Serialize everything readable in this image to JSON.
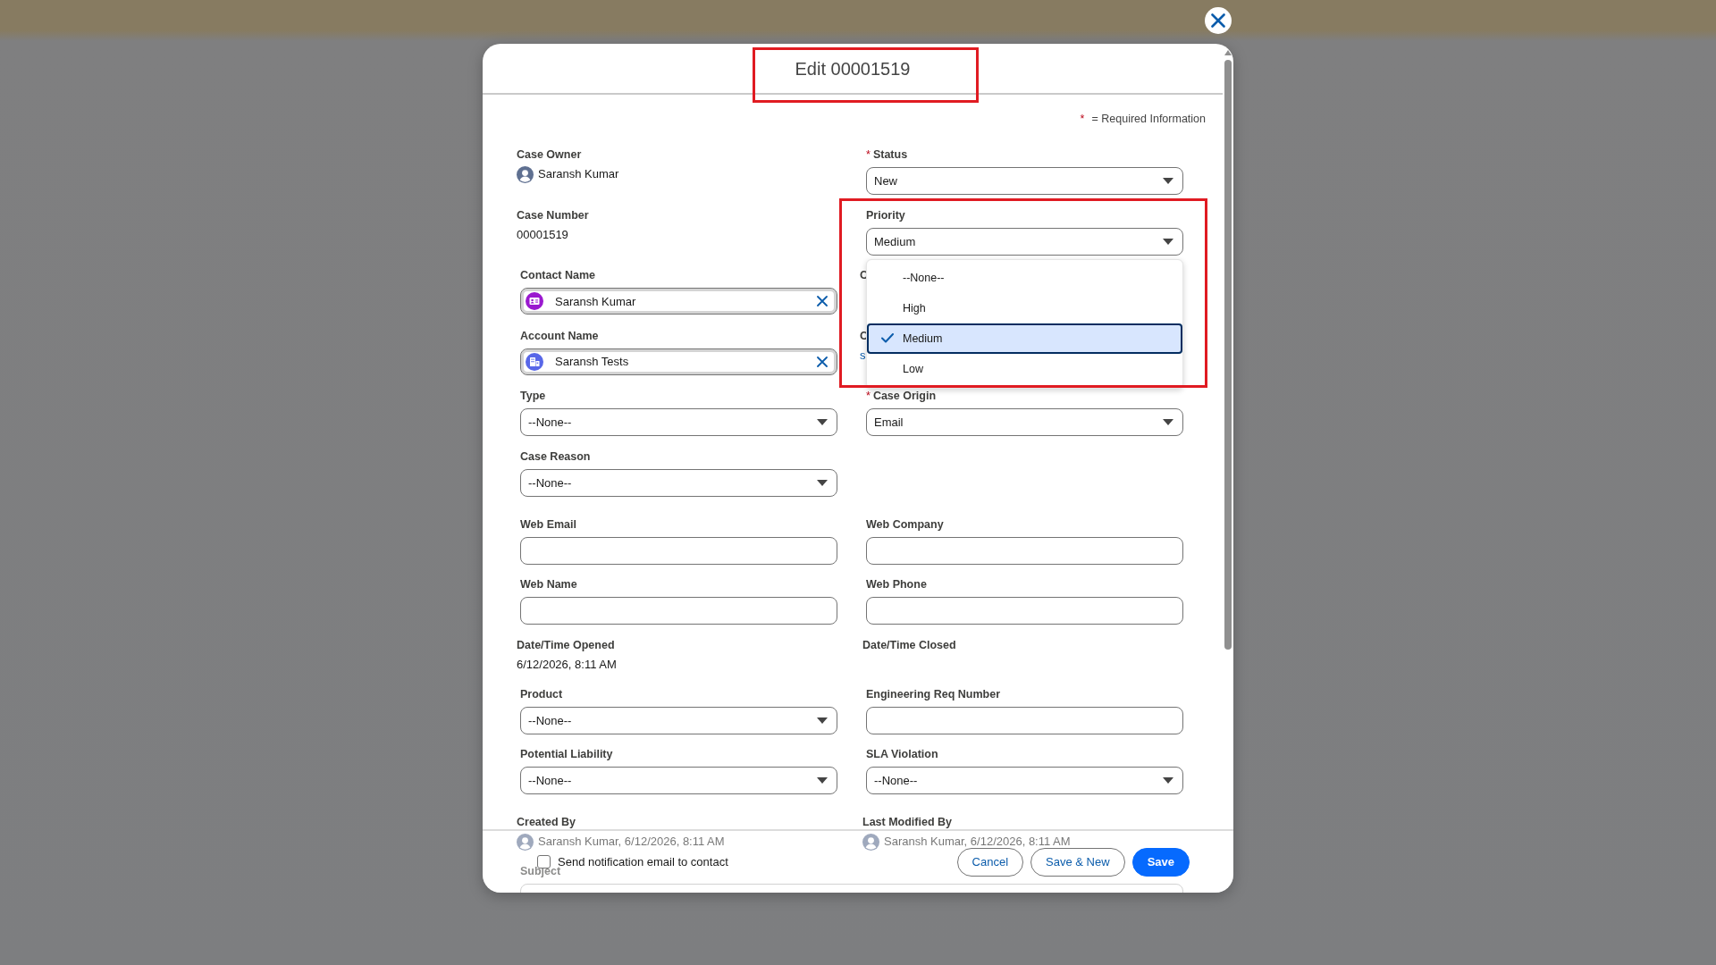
{
  "header": {
    "title": "Edit 00001519",
    "highlighted": true
  },
  "required_note": {
    "mark": "*",
    "text": "= Required Information"
  },
  "sections": [
    {
      "fields": [
        {
          "kind": "user",
          "label": "Case Owner",
          "value": "Saransh Kumar",
          "required": false,
          "highlighted": false
        },
        {
          "kind": "picklist",
          "label": "Status",
          "value": "New",
          "required": true,
          "mark": "*",
          "highlighted": false,
          "open": false
        },
        {
          "kind": "readonly",
          "label": "Case Number",
          "value": "00001519",
          "required": false,
          "highlighted": false
        },
        {
          "kind": "picklist",
          "label": "Priority",
          "value": "Medium",
          "required": false,
          "highlighted": true,
          "open": true
        },
        {
          "kind": "contact",
          "label": "Contact Name",
          "value": "Saransh Kumar",
          "required": false,
          "highlighted": false
        },
        {
          "kind": "covered",
          "label": "C",
          "required": false,
          "highlighted": false
        },
        {
          "kind": "account",
          "label": "Account Name",
          "value": "Saransh Tests",
          "required": false,
          "highlighted": false
        },
        {
          "kind": "covered",
          "label": "C",
          "value": "s",
          "required": false,
          "highlighted": false
        },
        {
          "kind": "picklist",
          "label": "Type",
          "value": "--None--",
          "required": false,
          "highlighted": false,
          "open": false
        },
        {
          "kind": "picklist",
          "label": "Case Origin",
          "value": "Email",
          "required": true,
          "mark": "*",
          "highlighted": false,
          "open": false
        },
        {
          "kind": "picklist",
          "label": "Case Reason",
          "value": "--None--",
          "required": false,
          "highlighted": false,
          "open": false
        }
      ]
    },
    {
      "fields": [
        {
          "kind": "text",
          "label": "Web Email",
          "required": false,
          "highlighted": false
        },
        {
          "kind": "text",
          "label": "Web Company",
          "required": false,
          "highlighted": false
        },
        {
          "kind": "text",
          "label": "Web Name",
          "required": false,
          "highlighted": false
        },
        {
          "kind": "text",
          "label": "Web Phone",
          "required": false,
          "highlighted": false
        },
        {
          "kind": "readonly",
          "label": "Date/Time Opened",
          "value": "6/12/2026, 8:11 AM",
          "required": false,
          "highlighted": false
        },
        {
          "kind": "readonly",
          "label": "Date/Time Closed",
          "required": false,
          "highlighted": false
        },
        {
          "kind": "picklist",
          "label": "Product",
          "value": "--None--",
          "required": false,
          "highlighted": false,
          "open": false
        },
        {
          "kind": "text",
          "label": "Engineering Req Number",
          "required": false,
          "highlighted": false
        },
        {
          "kind": "picklist",
          "label": "Potential Liability",
          "value": "--None--",
          "required": false,
          "highlighted": false,
          "open": false
        },
        {
          "kind": "picklist",
          "label": "SLA Violation",
          "value": "--None--",
          "required": false,
          "highlighted": false,
          "open": false
        }
      ]
    },
    {
      "fields": [
        {
          "kind": "user",
          "label": "Created By",
          "value": "Saransh Kumar, 6/12/2026, 8:11 AM",
          "required": false,
          "highlighted": false
        },
        {
          "kind": "user",
          "label": "Last Modified By",
          "value": "Saransh Kumar, 6/12/2026, 8:11 AM",
          "required": false,
          "highlighted": false
        },
        {
          "kind": "wide_text",
          "label": "Subject",
          "required": false,
          "highlighted": false
        }
      ]
    }
  ],
  "dropdown": {
    "options": [
      {
        "label": "--None--",
        "selected": false
      },
      {
        "label": "High",
        "selected": false
      },
      {
        "label": "Medium",
        "selected": true
      },
      {
        "label": "Low",
        "selected": false
      }
    ]
  },
  "footer": {
    "notify": {
      "label": "Send notification email to contact",
      "checked": false
    },
    "buttons": [
      {
        "label": "Cancel",
        "kind": "neutral"
      },
      {
        "label": "Save & New",
        "kind": "neutral"
      },
      {
        "label": "Save",
        "kind": "brand"
      }
    ]
  }
}
